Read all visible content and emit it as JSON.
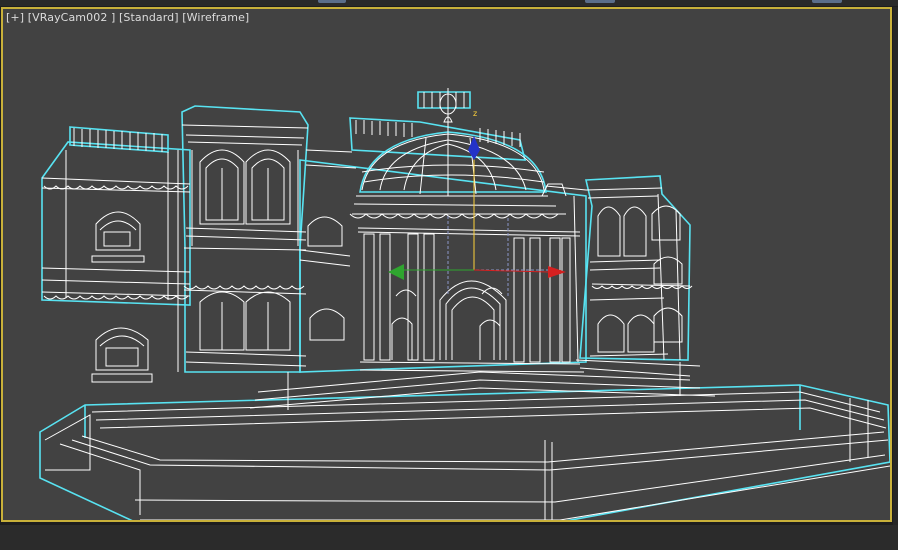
{
  "viewport": {
    "label_parts": [
      "[+]",
      "[VRayCam002 ]",
      "[Standard]",
      "[Wireframe]"
    ]
  },
  "colors": {
    "viewport_bg": "#424242",
    "active_border": "#c9b13a",
    "selection_outline": "#58e3f2",
    "wire": "#ffffff",
    "gizmo_x": "#d52020",
    "gizmo_y": "#2fa52f",
    "gizmo_z": "#2433c8"
  },
  "icons": [
    "axis-gizmo-icon"
  ]
}
